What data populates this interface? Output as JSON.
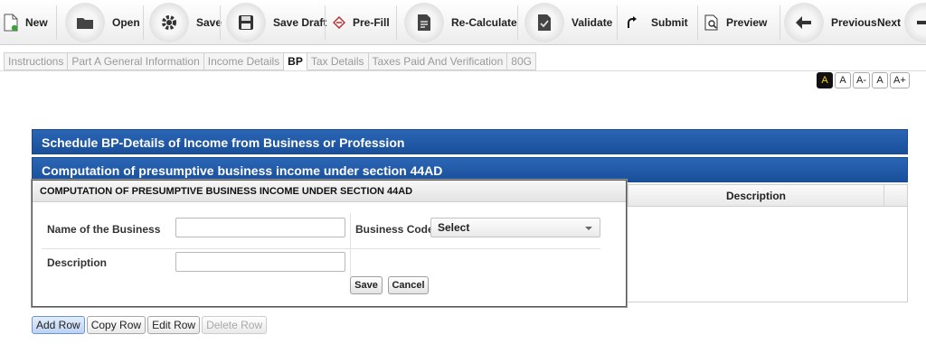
{
  "toolbar": {
    "new": "New",
    "open": "Open",
    "save": "Save",
    "save_draft": "Save Draft",
    "prefill": "Pre-Fill",
    "recalculate": "Re-Calculate",
    "validate": "Validate",
    "submit": "Submit",
    "preview": "Preview",
    "previous": "Previous",
    "next": "Next"
  },
  "tabs": [
    {
      "label": "Instructions",
      "active": false
    },
    {
      "label": "Part A General Information",
      "active": false
    },
    {
      "label": "Income Details",
      "active": false
    },
    {
      "label": "BP",
      "active": true
    },
    {
      "label": "Tax Details",
      "active": false
    },
    {
      "label": "Taxes Paid And Verification",
      "active": false
    },
    {
      "label": "80G",
      "active": false
    }
  ],
  "font_buttons": [
    "A",
    "A",
    "A-",
    "A",
    "A+"
  ],
  "schedule_title": "Schedule BP-Details of Income from Business or Profession",
  "section_title": "Computation of presumptive business income under section 44AD",
  "grid": {
    "description_header": "Description"
  },
  "dialog": {
    "title": "COMPUTATION OF PRESUMPTIVE BUSINESS INCOME UNDER SECTION 44AD",
    "name_label": "Name of the Business",
    "name_value": "",
    "business_code_label": "Business Code",
    "business_code_value": "Select",
    "description_label": "Description",
    "description_value": "",
    "save_label": "Save",
    "cancel_label": "Cancel"
  },
  "row_buttons": {
    "add": "Add Row",
    "copy": "Copy Row",
    "edit": "Edit Row",
    "delete": "Delete Row"
  },
  "colors": {
    "header_blue": "#1f58a6",
    "active_font_btn": "#ffd200"
  }
}
